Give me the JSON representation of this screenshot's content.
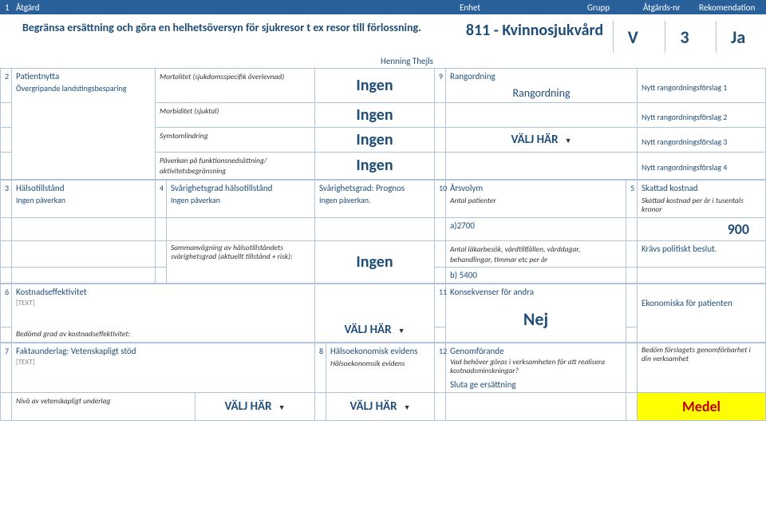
{
  "header": {
    "c1": "1",
    "atgard": "Åtgärd",
    "enhet": "Enhet",
    "grupp": "Grupp",
    "atgardsnr": "Åtgärds-nr",
    "rekommendation": "Rekomendation"
  },
  "top": {
    "title": "Begränsa ersättning och göra en helhetsöversyn för sjukresor t ex resor till förlossning.",
    "vgr": "811 - Kvinnosjukvård",
    "vgr_sub": "Henning Thejls",
    "v": "V",
    "n": "3",
    "ja": "Ja"
  },
  "s2": {
    "num": "2",
    "title": "Patientnytta",
    "sub": "Övergripande landstingsbesparing",
    "rows": [
      {
        "label": "Mortalitet (sjukdomsspecifik överlevnad)",
        "val": "Ingen"
      },
      {
        "label": "Morbiditet (sjuktal)",
        "val": "Ingen"
      },
      {
        "label": "Symtomlindring",
        "val": "Ingen"
      },
      {
        "label": "Påverkan på funktionsnedsättning/ aktivitetsbegränsning",
        "val": "Ingen"
      }
    ]
  },
  "s9": {
    "num": "9",
    "title": "Rangordning",
    "rang": "Rangordning",
    "valj": "VÄLJ HÄR",
    "nyt1": "Nytt rangordningsförslag 1",
    "nyt2": "Nytt rangordningsförslag 2",
    "nyt3": "Nytt rangordningsförslag 3",
    "nyt4": "Nytt rangordningsförslag 4"
  },
  "s3": {
    "num": "3",
    "title": "Hälsotillstånd",
    "val": "Ingen påverkan"
  },
  "s4": {
    "num": "4",
    "title": "Svårighetsgrad hälsotillstånd",
    "val": "Ingen påverkan",
    "sub2": "Sammanvägning av hälsotillståndets svårighetsgrad (aktuellt tillstånd + risk):",
    "sub2val": "Ingen"
  },
  "sProg": {
    "title": "Svårighetsgrad: Prognos",
    "val": "Ingen påverkan."
  },
  "s10": {
    "num": "10",
    "title": "Årsvolym",
    "sub1": "Antal patienter",
    "a": "a)2700",
    "sub2": "Antal läkarbesök, vårdtillfällen, vårddagar, behandlingar, timmar etc per år",
    "b": "b) 5400"
  },
  "s5": {
    "num": "5",
    "title": "Skattad kostnad",
    "sub": "Skattad kostnad per år i tusentals kronor",
    "val": "900",
    "note": "Krävs politiskt beslut."
  },
  "s6": {
    "num": "6",
    "title": "Kostnadseffektivitet",
    "body": "[TEXT]",
    "footer": "Bedömd grad av kostnadseffektivitet:",
    "valj": "VÄLJ HÄR"
  },
  "s11": {
    "num": "11",
    "title": "Konsekvenser för andra",
    "val": "Nej",
    "note": "Ekonomiska för patienten"
  },
  "s7": {
    "num": "7",
    "title": "Faktaunderlag: Vetenskapligt stöd",
    "body": "[TEXT]",
    "footer": "Nivå av vetenskapligt underlag",
    "valj": "VÄLJ HÄR"
  },
  "s8": {
    "num": "8",
    "title": "Hälsoekonomisk evidens",
    "sub": "Hälsoekonomsik evidens",
    "valj": "VÄLJ HÄR"
  },
  "s12": {
    "num": "12",
    "title": "Genomförande",
    "q": "Vad behöver göras i verksamheten för att realisera kostnadsminskningar?",
    "ans": "Sluta ge ersättning",
    "right": "Bedöm förslagets genomförbarhet i din verksamhet",
    "medel": "Medel"
  }
}
